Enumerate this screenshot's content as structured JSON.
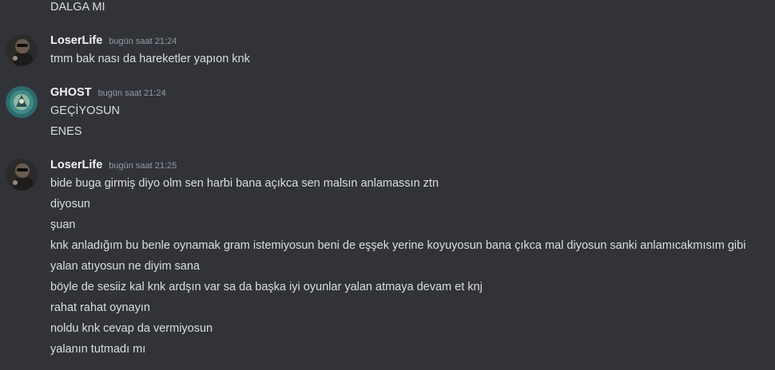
{
  "continuation": {
    "text": "DALGA MI"
  },
  "messages": [
    {
      "author": "LoserLife",
      "time": "bugün saat 21:24",
      "avatar_icon": "dark-portrait-avatar",
      "lines": [
        "tmm bak nası da hareketler yapıon knk"
      ]
    },
    {
      "author": "GHOST",
      "time": "bugün saat 21:24",
      "avatar_icon": "teal-emblem-avatar",
      "lines": [
        "GEÇİYOSUN",
        "ENES"
      ]
    },
    {
      "author": "LoserLife",
      "time": "bugün saat 21:25",
      "avatar_icon": "dark-portrait-avatar",
      "lines": [
        "bide buga girmiş diyo olm sen harbi bana açıkca sen malsın anlamassın ztn",
        "diyosun",
        "şuan",
        "knk anladığım bu benle oynamak gram istemiyosun beni de eşşek yerine koyuyosun bana çıkca mal diyosun sanki anlamıcakmısım gibi",
        "yalan atıyosun ne diyim sana",
        "böyle de sesiiz kal knk ardşın var sa da başka iyi oyunlar yalan atmaya devam et knj",
        "rahat rahat oynayın",
        "noldu knk cevap da vermiyosun",
        "yalanın tutmadı mı"
      ]
    }
  ],
  "colors": {
    "background": "#313338",
    "message_text": "#dbdee1",
    "username": "#f2f3f5",
    "timestamp": "#949ba4"
  }
}
